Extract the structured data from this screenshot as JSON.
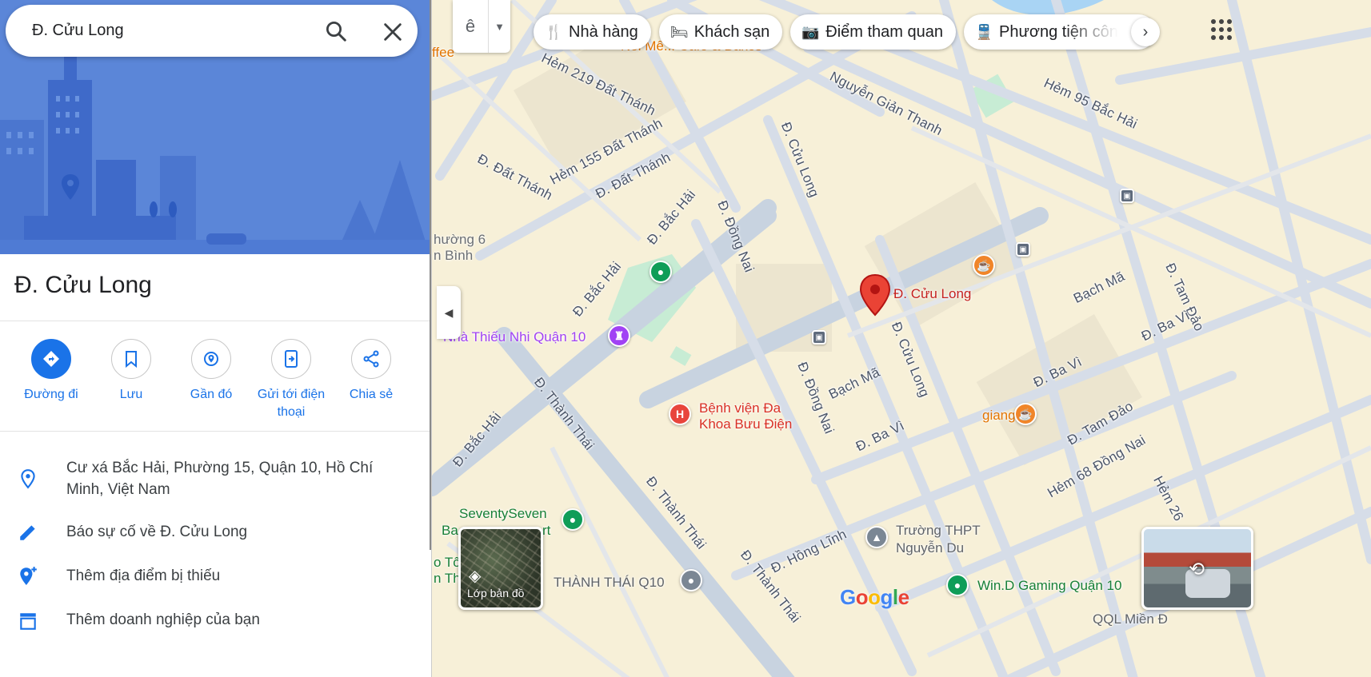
{
  "search": {
    "value": "Đ. Cửu Long"
  },
  "place": {
    "title": "Đ. Cửu Long"
  },
  "actions": [
    {
      "label": "Đường đi"
    },
    {
      "label": "Lưu"
    },
    {
      "label": "Gần đó"
    },
    {
      "label": "Gửi tới điện thoại"
    },
    {
      "label": "Chia sẻ"
    }
  ],
  "info": {
    "address": "Cư xá Bắc Hải, Phường 15, Quận 10, Hồ Chí Minh, Việt Nam",
    "report": "Báo sự cố về Đ. Cửu Long",
    "add_place": "Thêm địa điểm bị thiếu",
    "add_business": "Thêm doanh nghiệp của bạn"
  },
  "chips": [
    {
      "label": "Nhà hàng",
      "icon": "restaurant-icon"
    },
    {
      "label": "Khách sạn",
      "icon": "hotel-icon"
    },
    {
      "label": "Điểm tham quan",
      "icon": "camera-icon"
    },
    {
      "label": "Phương tiện công c",
      "icon": "transit-icon"
    }
  ],
  "layers": {
    "label": "Lớp bản đồ"
  },
  "logo": "Google",
  "map": {
    "pin_label": "Đ. Cửu Long",
    "streets": [
      "Hẻm 219 Đất Thánh",
      "Đ. Đất Thánh",
      "Hẻm 155 Đất Thánh",
      "Đ. Đất Thánh",
      "Nguyễn Giản Thanh",
      "Hẻm 95 Bắc Hải",
      "Đ. Cửu Long",
      "Đ. Bắc Hải",
      "Đ. Đồng Nai",
      "Đ. Bắc Hải",
      "Bạch Mã",
      "Đ. Tam Đảo",
      "Đ. Ba Vì",
      "Đ. Cửu Long",
      "Đ. Đồng Nai",
      "Bạch Mã",
      "Đ. Ba Vì",
      "Đ. Ba Vì",
      "Đ. Tam Đảo",
      "Hẻm 68 Đồng Nai",
      "Đ. Bắc Hải",
      "Đ. Thành Thái",
      "Đ. Thành Thái",
      "Đ. Hồng Lĩnh",
      "Đ. Thành Thái",
      "Hẻm 26"
    ],
    "pois": {
      "ward": "hường 6",
      "ward2": "n Bình",
      "nha_thieu_nhi": "Nhà Thiếu Nhi Quận 10",
      "hospital_1": "Bệnh viện Đa",
      "hospital_2": "Khoa Bưu Điện",
      "cafe_giang": "giang",
      "seventyseven": "SeventySeven",
      "ba_rt": "Ba",
      "rt": "rt",
      "school_1": "Trường THPT",
      "school_2": "Nguyễn Du",
      "thanh_thai": "THÀNH THÁI Q10",
      "gaming": "Win.D Gaming Quận 10",
      "top_cafe": "Noi Mê... Cafe & Bakes",
      "fee": "ffee",
      "to": "o Tô",
      "th": "n Th",
      "bottom": "QQL Miền Đ"
    }
  }
}
